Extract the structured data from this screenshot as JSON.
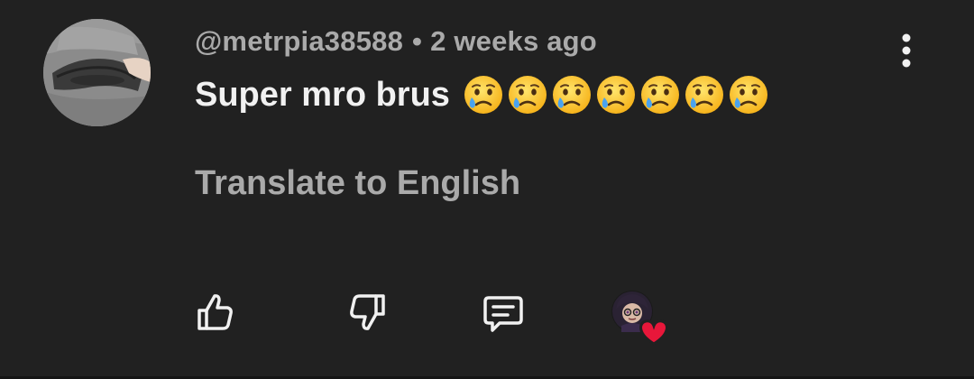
{
  "comment": {
    "username": "@metrpia38588",
    "separator": "•",
    "timestamp": "2 weeks ago",
    "text": "Super mro brus",
    "emoji_count": 7,
    "emoji_name": "crying-face",
    "translate_label": "Translate to English"
  },
  "actions": {
    "like_icon": "thumbs-up-icon",
    "dislike_icon": "thumbs-down-icon",
    "reply_icon": "reply-comment-icon",
    "creator_heart": "creator-heart-badge",
    "more_icon": "vertical-ellipsis-icon"
  },
  "colors": {
    "background": "#212121",
    "primary_text": "#f1f1f1",
    "secondary_text": "#aaaaaa",
    "heart": "#e8173a"
  }
}
